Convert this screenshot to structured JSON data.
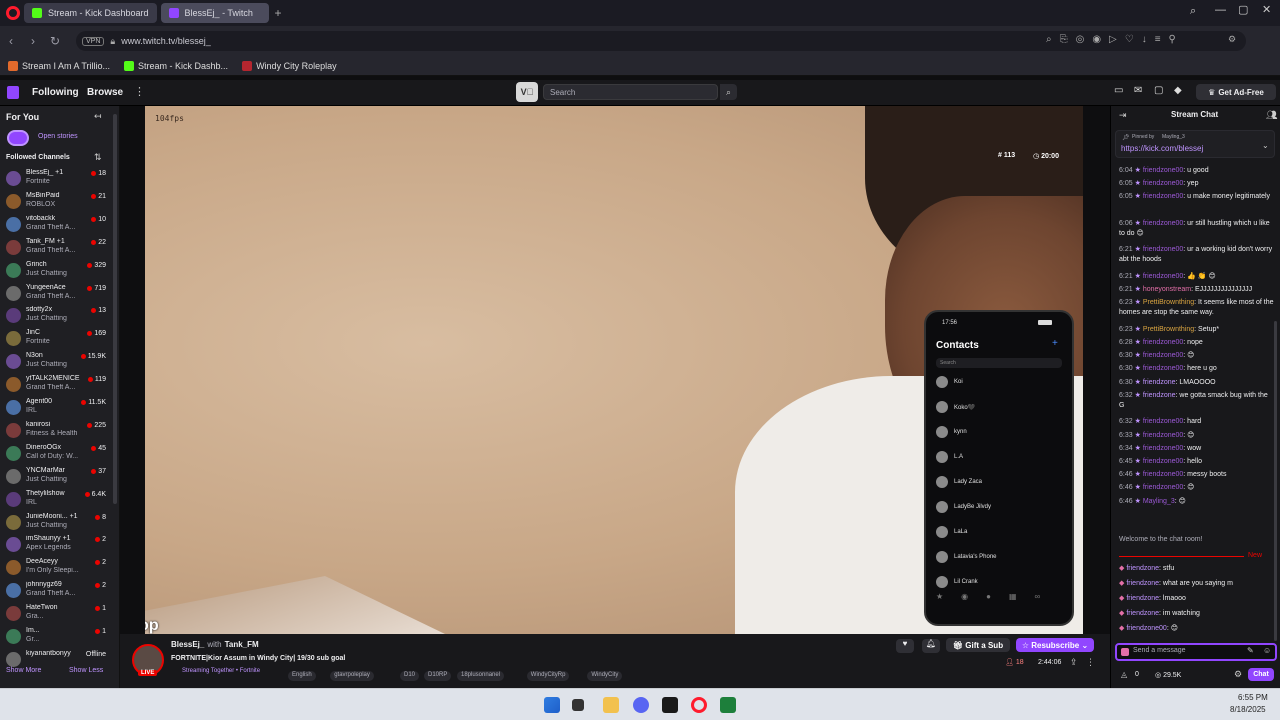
{
  "browser": {
    "tabs": [
      {
        "label": "Stream - Kick Dashboard",
        "active": true
      },
      {
        "label": "BlessEj_ - Twitch",
        "active": false
      }
    ],
    "url": "www.twitch.tv/blessej_",
    "vpn_label": "VPN",
    "bookmarks": [
      "Stream I Am A Trillio...",
      "Stream - Kick Dashb...",
      "Windy City Roleplay"
    ]
  },
  "twitch_nav": {
    "following": "Following",
    "browse": "Browse",
    "search_placeholder": "Search",
    "ad_free": "Get Ad-Free"
  },
  "sidebar": {
    "for_you": "For You",
    "open_stories": "Open stories",
    "followed_channels": "Followed Channels",
    "show_more": "Show More",
    "show_less": "Show Less",
    "channels": [
      {
        "name": "BlessEj_ +1",
        "game": "Fortnite",
        "viewers": "18"
      },
      {
        "name": "MsBinPaid",
        "game": "ROBLOX",
        "viewers": "21"
      },
      {
        "name": "vitobackk",
        "game": "Grand Theft A...",
        "viewers": "10"
      },
      {
        "name": "Tank_FM +1",
        "game": "Grand Theft A...",
        "viewers": "22"
      },
      {
        "name": "Grinch",
        "game": "Just Chatting",
        "viewers": "329"
      },
      {
        "name": "YungeenAce",
        "game": "Grand Theft A...",
        "viewers": "719"
      },
      {
        "name": "sdotty2x",
        "game": "Just Chatting",
        "viewers": "13"
      },
      {
        "name": "JinC",
        "game": "Fortnite",
        "viewers": "169"
      },
      {
        "name": "N3on",
        "game": "Just Chatting",
        "viewers": "15.9K"
      },
      {
        "name": "ytTALK2MENICE",
        "game": "Grand Theft A...",
        "viewers": "119"
      },
      {
        "name": "Agent00",
        "game": "IRL",
        "viewers": "11.5K"
      },
      {
        "name": "kanirosi",
        "game": "Fitness & Health",
        "viewers": "225"
      },
      {
        "name": "DineroOGx",
        "game": "Call of Duty: W...",
        "viewers": "45"
      },
      {
        "name": "YNCMarMar",
        "game": "Just Chatting",
        "viewers": "37"
      },
      {
        "name": "Thetylilshow",
        "game": "IRL",
        "viewers": "6.4K"
      },
      {
        "name": "JunieMooni... +1",
        "game": "Just Chatting",
        "viewers": "8"
      },
      {
        "name": "imShaunyy +1",
        "game": "Apex Legends",
        "viewers": "2"
      },
      {
        "name": "DeeAceyy",
        "game": "I'm Only Sleepi...",
        "viewers": "2"
      },
      {
        "name": "johnnygz69",
        "game": "Grand Theft A...",
        "viewers": "2"
      },
      {
        "name": "HateTwon",
        "game": "Gra...",
        "viewers": "1"
      },
      {
        "name": "Im...",
        "game": "Gr...",
        "viewers": "1"
      },
      {
        "name": "kiyanantbonyy",
        "game": "",
        "viewers": "Offline"
      }
    ]
  },
  "video": {
    "fps": "104fps",
    "hud_count": "113",
    "hud_time": "20:00",
    "watermark": "wheresyop",
    "phone": {
      "time": "17:56",
      "title": "Contacts",
      "search": "Search",
      "contacts": [
        "Koi",
        "Koko🖤",
        "kynn",
        "L.A",
        "Lady Zaca",
        "LadyBe Jilvdy",
        "LaLa",
        "Latavia's Phone",
        "Lil Crank"
      ]
    }
  },
  "stream_info": {
    "streamer": "BlessEj_",
    "with": "with",
    "collab": "Tank_FM",
    "title": "FORTNITE|Kior Assum in Windy City| 19/30 sub goal",
    "streaming_together": "Streaming Together • Fortnite",
    "tags": [
      "English",
      "gtavrpoleplay",
      "D10",
      "D10RP",
      "18plusonnanel",
      "WindyCityRp",
      "WindyCity"
    ],
    "viewers": "18",
    "uptime": "2:44:06",
    "gift_sub": "Gift a Sub",
    "resubscribe": "Resubscribe",
    "live": "LIVE"
  },
  "chat": {
    "header": "Stream Chat",
    "pinned_by": "Pinned by",
    "pinned_user": "Mayling_3",
    "pinned_link": "https://kick.com/blessej",
    "messages": [
      {
        "t": "6:04",
        "u": "friendzone00",
        "m": ": u good"
      },
      {
        "t": "6:05",
        "u": "friendzone00",
        "m": ": yep"
      },
      {
        "t": "6:05",
        "u": "friendzone00",
        "m": ": u make money legitimately"
      },
      {
        "t": "6:06",
        "u": "friendzone00",
        "m": ": ur still hustling which u like to do 😊"
      },
      {
        "t": "6:21",
        "u": "friendzone00",
        "m": ": ur a working kid don't worry abt the hoods"
      },
      {
        "t": "6:21",
        "u": "friendzone00",
        "m": ": 👍 👏 😊"
      },
      {
        "t": "6:21",
        "u": "honeyonstream",
        "m": ": EJJJJJJJJJJJJJJJ"
      },
      {
        "t": "6:23",
        "u": "PrettiBrownthing",
        "m": ": It seems like most of the homes are stop the same way."
      },
      {
        "t": "6:23",
        "u": "PrettiBrownthing",
        "m": ": Setup*"
      },
      {
        "t": "6:28",
        "u": "friendzone00",
        "m": ": nope"
      },
      {
        "t": "6:30",
        "u": "friendzone00",
        "m": ": 😊"
      },
      {
        "t": "6:30",
        "u": "friendzone00",
        "m": ": here u go"
      },
      {
        "t": "6:30",
        "u": "friendzone",
        "m": ": LMAOOOO"
      },
      {
        "t": "6:32",
        "u": "friendzone",
        "m": ": we gotta smack bug with the G"
      },
      {
        "t": "6:32",
        "u": "friendzone00",
        "m": ": hard"
      },
      {
        "t": "6:33",
        "u": "friendzone00",
        "m": ": 😊"
      },
      {
        "t": "6:34",
        "u": "friendzone00",
        "m": ": wow"
      },
      {
        "t": "6:45",
        "u": "friendzone00",
        "m": ": hello"
      },
      {
        "t": "6:46",
        "u": "friendzone00",
        "m": ": messy boots"
      },
      {
        "t": "6:46",
        "u": "friendzone00",
        "m": ": 😊"
      },
      {
        "t": "6:46",
        "u": "Mayling_3",
        "m": ": 😊"
      }
    ],
    "welcome": "Welcome to the chat room!",
    "new_label": "New",
    "recent": [
      {
        "u": "friendzone",
        "m": ": stfu"
      },
      {
        "u": "friendzone",
        "m": ": what are you saying m"
      },
      {
        "u": "friendzone",
        "m": ": lmaooo"
      },
      {
        "u": "friendzone",
        "m": ": im watching"
      },
      {
        "u": "friendzone00",
        "m": ": 😊"
      }
    ],
    "input_placeholder": "Send a message",
    "points": "0",
    "points2": "29.5K",
    "chat_button": "Chat"
  },
  "taskbar": {
    "time": "6:55 PM",
    "date": "8/18/2025"
  }
}
